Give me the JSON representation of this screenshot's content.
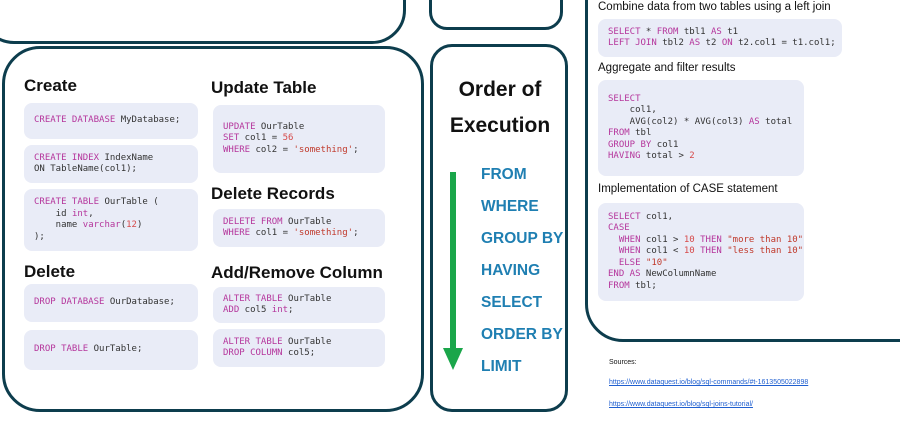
{
  "left": {
    "create": {
      "heading": "Create",
      "db": [
        "CREATE DATABASE",
        " MyDatabase;"
      ],
      "index": [
        "CREATE INDEX",
        " IndexName",
        "ON TableName(col1);"
      ],
      "table": [
        "CREATE TABLE",
        " OurTable (",
        "    id ",
        "int",
        ",",
        "    name ",
        "varchar",
        "(",
        "12",
        ")",
        ");"
      ]
    },
    "update": {
      "heading": "Update Table",
      "l1": [
        "UPDATE",
        " OurTable"
      ],
      "l2": [
        "SET",
        " col1 = ",
        "56"
      ],
      "l3": [
        "WHERE",
        " col2 = ",
        "'something'",
        ";"
      ]
    },
    "deleteRecords": {
      "heading": "Delete Records",
      "l1": [
        "DELETE FROM",
        " OurTable"
      ],
      "l2": [
        "WHERE",
        " col1 = ",
        "'something'",
        ";"
      ]
    },
    "delete": {
      "heading": "Delete",
      "db": [
        "DROP DATABASE",
        " OurDatabase;"
      ],
      "table": [
        "DROP TABLE",
        " OurTable;"
      ]
    },
    "addRemove": {
      "heading": "Add/Remove Column",
      "add1": [
        "ALTER TABLE",
        " OurTable"
      ],
      "add2": [
        "ADD",
        " col5 ",
        "int",
        ";"
      ],
      "drop1": [
        "ALTER TABLE",
        " OurTable"
      ],
      "drop2": [
        "DROP COLUMN",
        " col5;"
      ]
    }
  },
  "order": {
    "title_line1": "Order of",
    "title_line2": "Execution",
    "steps": [
      "FROM",
      "WHERE",
      "GROUP BY",
      "HAVING",
      "SELECT",
      "ORDER BY",
      "LIMIT"
    ],
    "arrow_color": "#1aa64a"
  },
  "right": {
    "join_label": "Combine data from two tables using a left join",
    "join": {
      "l1": [
        "SELECT",
        " * ",
        "FROM",
        " tbl1 ",
        "AS",
        " t1"
      ],
      "l2": [
        "LEFT JOIN",
        " tbl2 ",
        "AS",
        " t2 ",
        "ON",
        " t2.col1 = t1.col1;"
      ]
    },
    "agg_label": "Aggregate and filter results",
    "agg": {
      "l1": "SELECT",
      "l2": "    col1,",
      "l3": [
        "    AVG(col2) * AVG(col3) ",
        "AS",
        " total"
      ],
      "l4": [
        "FROM",
        " tbl"
      ],
      "l5": [
        "GROUP BY",
        " col1"
      ],
      "l6": [
        "HAVING",
        " total > ",
        "2"
      ]
    },
    "case_label": "Implementation of CASE statement",
    "case": {
      "l1": [
        "SELECT",
        " col1,"
      ],
      "l2": "CASE",
      "l3": [
        "  WHEN",
        " col1 > ",
        "10",
        " THEN ",
        "\"more than 10\""
      ],
      "l4": [
        "  WHEN",
        " col1 < ",
        "10",
        " THEN ",
        "\"less than 10\""
      ],
      "l5": [
        "  ELSE",
        " ",
        "\"10\""
      ],
      "l6": [
        "END AS",
        " NewColumnName"
      ],
      "l7": [
        "FROM",
        " tbl;"
      ]
    }
  },
  "sources": {
    "label": "Sources:",
    "links": [
      "https://www.dataquest.io/blog/sql-commands/#t-1613505022898",
      "https://www.dataquest.io/blog/sql-joins-tutorial/"
    ]
  }
}
